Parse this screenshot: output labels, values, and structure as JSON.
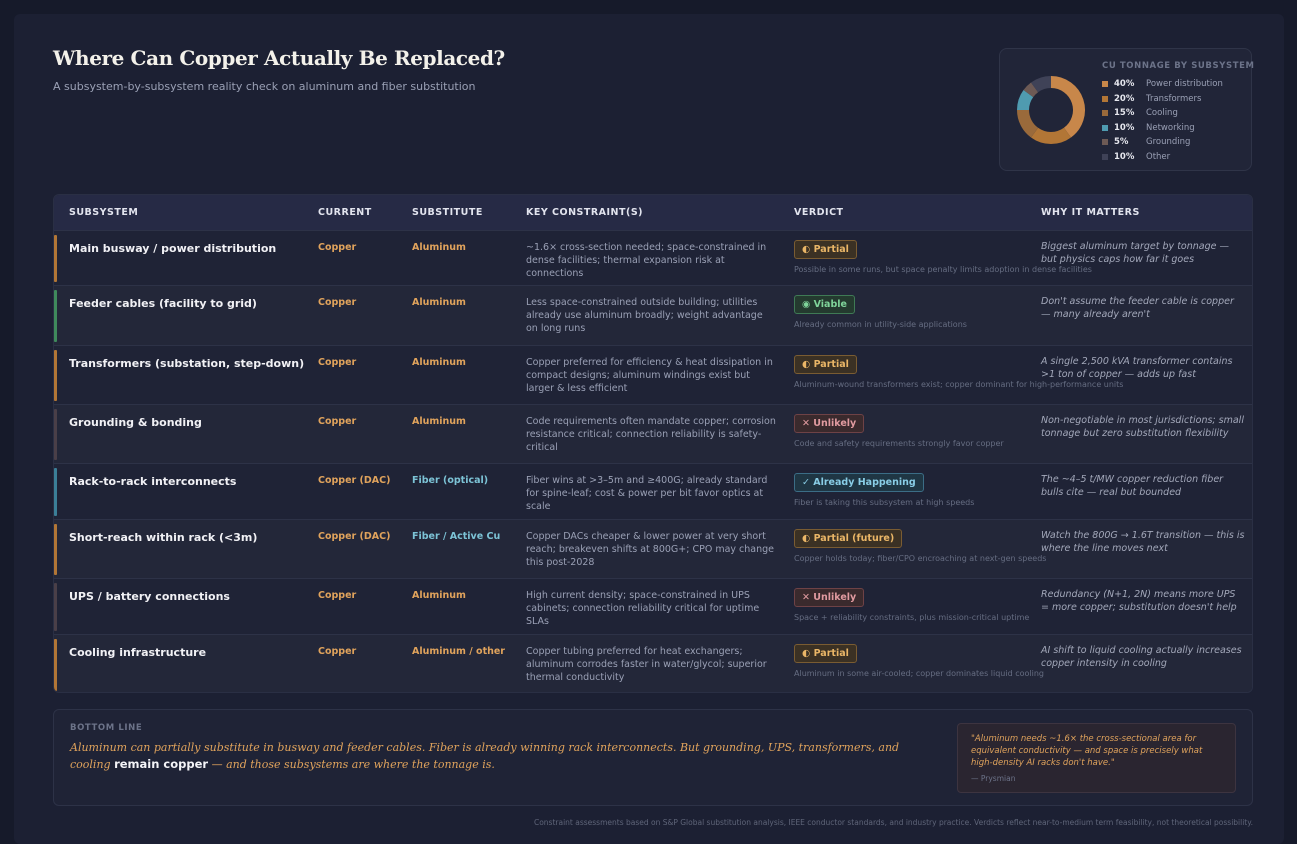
{
  "title": "Where Can Copper Actually Be Replaced?",
  "subtitle": "A subsystem-by-subsystem reality check on aluminum and fiber substitution",
  "donut": {
    "title": "CU TONNAGE BY SUBSYSTEM",
    "items": [
      {
        "pct": "40%",
        "label": "Power distribution",
        "value": 40,
        "color": "#c8874a"
      },
      {
        "pct": "20%",
        "label": "Transformers",
        "value": 20,
        "color": "#b27636"
      },
      {
        "pct": "15%",
        "label": "Cooling",
        "value": 15,
        "color": "#9a6a3b"
      },
      {
        "pct": "10%",
        "label": "Networking",
        "value": 10,
        "color": "#4f9bb0"
      },
      {
        "pct": "5%",
        "label": "Grounding",
        "value": 5,
        "color": "#6d5a55"
      },
      {
        "pct": "10%",
        "label": "Other",
        "value": 10,
        "color": "#3f4257"
      }
    ]
  },
  "table": {
    "headers": [
      "SUBSYSTEM",
      "CURRENT",
      "SUBSTITUTE",
      "KEY CONSTRAINT(S)",
      "VERDICT",
      "WHY IT MATTERS"
    ],
    "rows": [
      {
        "subsystem": "Main busway / power distribution",
        "current": "Copper",
        "substitute": "Aluminum",
        "substitute_color": "#e0a35c",
        "constraint": "~1.6× cross-section needed; space-constrained in dense facilities; thermal expansion risk at connections",
        "verdict": "◐ Partial",
        "verdict_type": "partial",
        "verdict_note": "Possible in some runs, but space penalty limits adoption in dense facilities",
        "why": "Biggest aluminum target by tonnage — but physics caps how far it goes",
        "bar_color": "#b27636"
      },
      {
        "subsystem": "Feeder cables (facility to grid)",
        "current": "Copper",
        "substitute": "Aluminum",
        "substitute_color": "#e0a35c",
        "constraint": "Less space-constrained outside building; utilities already use aluminum broadly; weight advantage on long runs",
        "verdict": "◉ Viable",
        "verdict_type": "viable",
        "verdict_note": "Already common in utility-side applications",
        "why": "Don't assume the feeder cable is copper — many already aren't",
        "bar_color": "#3f8a5c"
      },
      {
        "subsystem": "Transformers (substation, step-down)",
        "current": "Copper",
        "substitute": "Aluminum",
        "substitute_color": "#e0a35c",
        "constraint": "Copper preferred for efficiency & heat dissipation in compact designs; aluminum windings exist but larger & less efficient",
        "verdict": "◐ Partial",
        "verdict_type": "partial",
        "verdict_note": "Aluminum-wound transformers exist; copper dominant for high-performance units",
        "why": "A single 2,500 kVA transformer contains >1 ton of copper — adds up fast",
        "bar_color": "#b27636"
      },
      {
        "subsystem": "Grounding & bonding",
        "current": "Copper",
        "substitute": "Aluminum",
        "substitute_color": "#e0a35c",
        "constraint": "Code requirements often mandate copper; corrosion resistance critical; connection reliability is safety-critical",
        "verdict": "✕ Unlikely",
        "verdict_type": "unlikely",
        "verdict_note": "Code and safety requirements strongly favor copper",
        "why": "Non-negotiable in most jurisdictions; small tonnage but zero substitution flexibility",
        "bar_color": "#4a3f48"
      },
      {
        "subsystem": "Rack-to-rack interconnects",
        "current": "Copper (DAC)",
        "substitute": "Fiber (optical)",
        "substitute_color": "#7cc3d6",
        "constraint": "Fiber wins at >3–5m and ≥400G; already standard for spine-leaf; cost & power per bit favor optics at scale",
        "verdict": "✓ Already Happening",
        "verdict_type": "happening",
        "verdict_note": "Fiber is taking this subsystem at high speeds",
        "why": "The ~4–5 t/MW copper reduction fiber bulls cite — real but bounded",
        "bar_color": "#3b7f98"
      },
      {
        "subsystem": "Short-reach within rack (<3m)",
        "current": "Copper (DAC)",
        "substitute": "Fiber / Active Cu",
        "substitute_color": "#7cc3d6",
        "constraint": "Copper DACs cheaper & lower power at very short reach; breakeven shifts at 800G+; CPO may change this post-2028",
        "verdict": "◐ Partial (future)",
        "verdict_type": "partial",
        "verdict_note": "Copper holds today; fiber/CPO encroaching at next-gen speeds",
        "why": "Watch the 800G → 1.6T transition — this is where the line moves next",
        "bar_color": "#b27636"
      },
      {
        "subsystem": "UPS / battery connections",
        "current": "Copper",
        "substitute": "Aluminum",
        "substitute_color": "#e0a35c",
        "constraint": "High current density; space-constrained in UPS cabinets; connection reliability critical for uptime SLAs",
        "verdict": "✕ Unlikely",
        "verdict_type": "unlikely",
        "verdict_note": "Space + reliability constraints, plus mission-critical uptime",
        "why": "Redundancy (N+1, 2N) means more UPS = more copper; substitution doesn't help",
        "bar_color": "#4a3f48"
      },
      {
        "subsystem": "Cooling infrastructure",
        "current": "Copper",
        "substitute": "Aluminum / other",
        "substitute_color": "#e0a35c",
        "constraint": "Copper tubing preferred for heat exchangers; aluminum corrodes faster in water/glycol; superior thermal conductivity",
        "verdict": "◐ Partial",
        "verdict_type": "partial",
        "verdict_note": "Aluminum in some air-cooled; copper dominates liquid cooling",
        "why": "AI shift to liquid cooling actually increases copper intensity in cooling",
        "bar_color": "#b27636"
      }
    ]
  },
  "bottom": {
    "label": "BOTTOM LINE",
    "text_a": "Aluminum can partially substitute in busway and feeder cables. Fiber is already winning rack interconnects. But grounding, UPS, transformers, and cooling ",
    "text_em": "remain copper",
    "text_b": " — and those subsystems are where the tonnage is.",
    "quote": "\"Aluminum needs ~1.6× the cross-sectional area for equivalent conductivity — and space is precisely what high-density AI racks don't have.\"",
    "quote_source": "— Prysmian"
  },
  "footnote": "Constraint assessments based on S&P Global substitution analysis, IEEE conductor standards, and industry practice. Verdicts reflect near-to-medium term feasibility, not theoretical possibility."
}
